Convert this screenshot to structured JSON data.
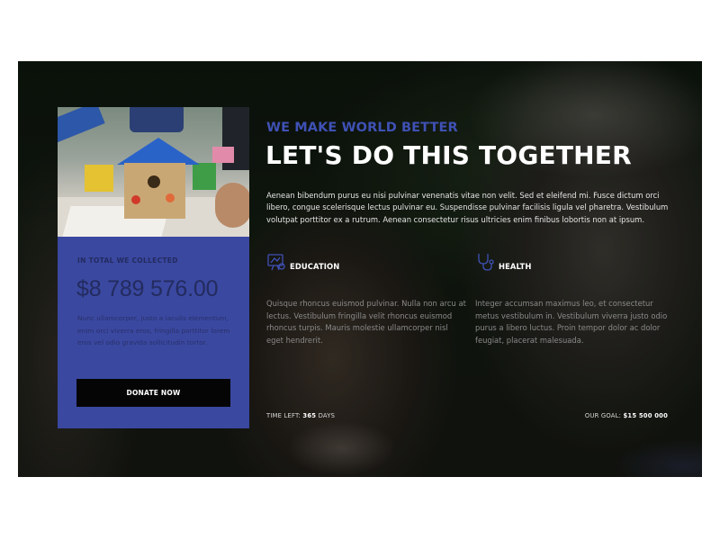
{
  "hero": {
    "kicker": "WE MAKE WORLD BETTER",
    "headline": "LET'S DO THIS TOGETHER",
    "intro": "Aenean bibendum purus eu nisi pulvinar venenatis vitae non velit. Sed et eleifend mi. Fusce dictum orci libero, congue scelerisque lectus pulvinar eu. Suspendisse pulvinar facilisis ligula vel pharetra. Vestibulum volutpat porttitor ex a rutrum. Aenean consectetur risus ultricies enim finibus lobortis non at ipsum."
  },
  "donation_card": {
    "label": "IN TOTAL WE COLLECTED",
    "amount": "$8 789 576.00",
    "description": "Nunc ullamcorper, justo a iaculis elementum, enim orci viverra eros, fringilla porttitor lorem eros vel odio gravida sollicitudin tortor.",
    "button_label": "DONATE NOW",
    "photo_icon": "birdhouse-photo"
  },
  "features": [
    {
      "icon": "education-icon",
      "title": "EDUCATION",
      "text": "Quisque rhoncus euismod pulvinar. Nulla non arcu at lectus. Vestibulum fringilla velit rhoncus euismod rhoncus turpis. Mauris molestie ullamcorper nisl eget hendrerit."
    },
    {
      "icon": "stethoscope-icon",
      "title": "HEALTH",
      "text": "Integer accumsan maximus leo, et consectetur metus vestibulum in. Vestibulum viverra justo odio purus a libero luctus. Proin tempor dolor ac dolor feugiat, placerat malesuada."
    }
  ],
  "stats": {
    "time_left_label": "TIME LEFT:",
    "time_left_value": "365",
    "time_left_unit": "DAYS",
    "goal_label": "OUR GOAL:",
    "goal_value": "$15 500 000"
  },
  "colors": {
    "accent": "#3f51b5",
    "card": "#3a48a0",
    "button": "#050505"
  }
}
